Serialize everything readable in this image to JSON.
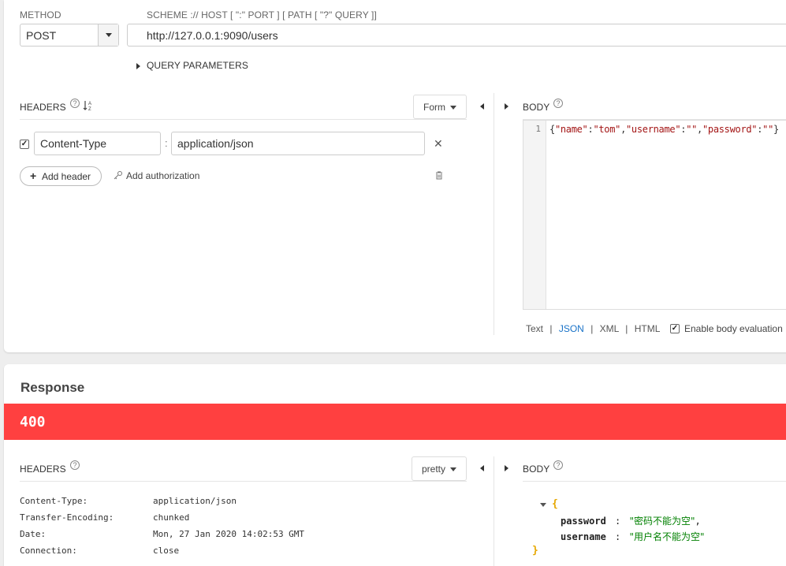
{
  "request": {
    "method_label": "METHOD",
    "method_value": "POST",
    "url_label": "SCHEME :// HOST [ \":\" PORT ] [ PATH [ \"?\" QUERY ]]",
    "url_value": "http://127.0.0.1:9090/users",
    "query_params_label": "QUERY PARAMETERS",
    "headers_label": "HEADERS",
    "sort_icon_text": "↓A/Z",
    "form_btn": "Form",
    "header_row": {
      "name": "Content-Type",
      "value": "application/json",
      "checked": true,
      "separator": ":"
    },
    "add_header": "Add header",
    "add_authorization": "Add authorization",
    "body_label": "BODY",
    "body_line_number": "1",
    "body_code": {
      "open": "{",
      "k1": "\"name\"",
      "c1": ":",
      "v1": "\"tom\"",
      "comma1": ",",
      "k2": "\"username\"",
      "c2": ":",
      "v2": "\"\"",
      "comma2": ",",
      "k3": "\"password\"",
      "c3": ":",
      "v3": "\"\"",
      "close": "}"
    },
    "format_text": "Text",
    "format_json": "JSON",
    "format_xml": "XML",
    "format_html": "HTML",
    "format_sep": "|",
    "enable_body_eval": "Enable body evaluation"
  },
  "response": {
    "title": "Response",
    "status_code": "400",
    "headers_label": "HEADERS",
    "pretty_btn": "pretty",
    "headers": [
      {
        "name": "Content-Type:",
        "value": "application/json"
      },
      {
        "name": "Transfer-Encoding:",
        "value": "chunked"
      },
      {
        "name": "Date:",
        "value": "Mon, 27 Jan 2020 14:02:53 GMT"
      },
      {
        "name": "Connection:",
        "value": "close"
      }
    ],
    "body_label": "BODY",
    "body_json": {
      "open": "{",
      "k1": "password",
      "sep1": ":",
      "v1": "\"密码不能为空\"",
      "comma": ",",
      "k2": "username",
      "sep2": ":",
      "v2": "\"用户名不能为空\"",
      "close": "}"
    }
  },
  "colors": {
    "status_error": "#ff4040",
    "json_key": "#a31515",
    "json_string_value": "#008000",
    "link_active": "#1a73c8",
    "brace": "#e6a700"
  },
  "icons": {
    "help": "help-circle-icon",
    "sort": "sort-alpha-icon",
    "close": "close-icon",
    "trash": "trash-icon",
    "key": "key-icon",
    "plus": "plus-icon"
  }
}
